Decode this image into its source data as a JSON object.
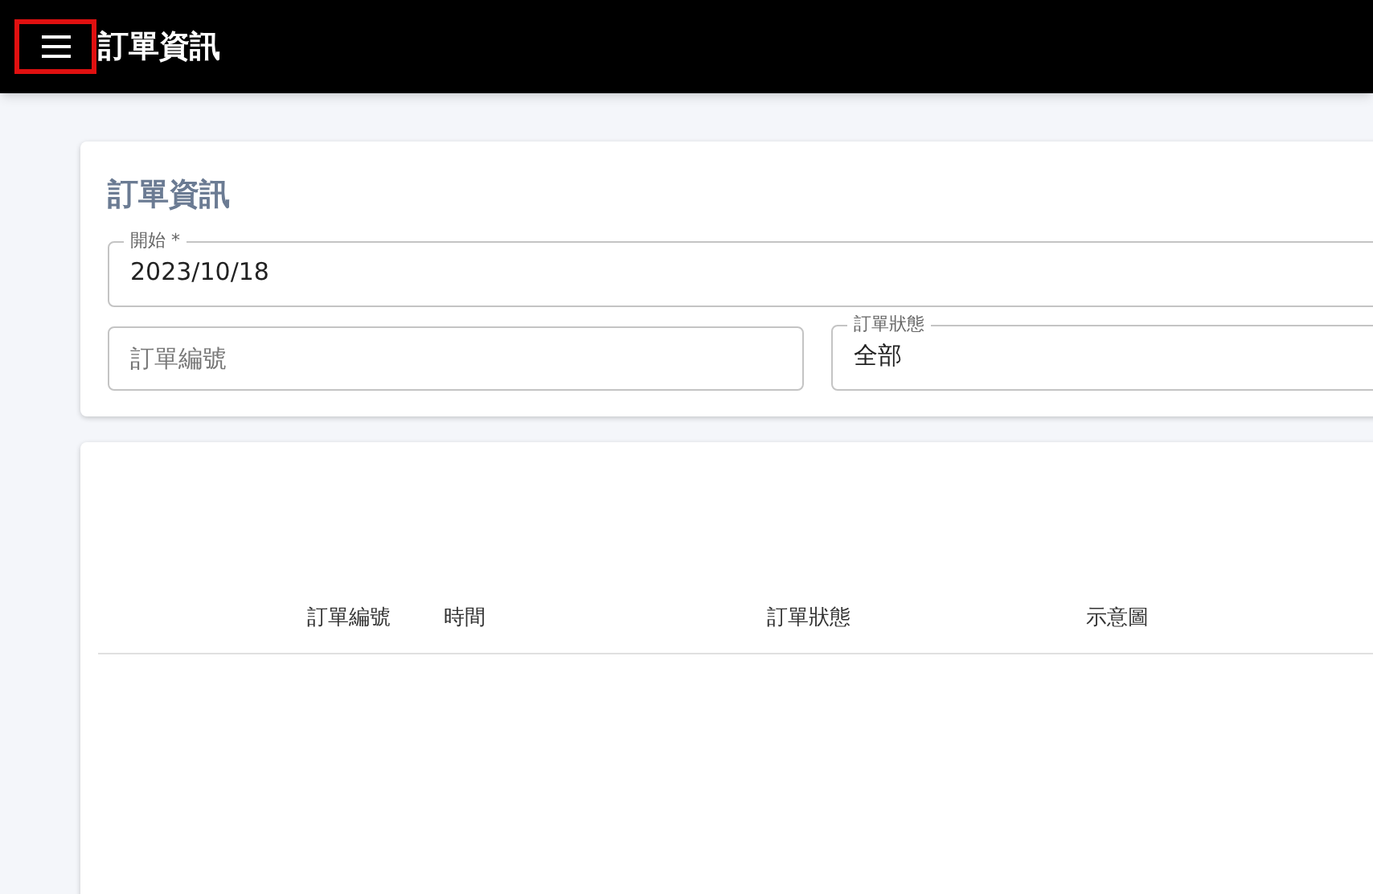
{
  "app_bar": {
    "title": "訂單資訊",
    "menu_highlighted": true
  },
  "filter_card": {
    "title": "訂單資訊",
    "start_field": {
      "label": "開始 *",
      "value": "2023/10/18"
    },
    "order_number_field": {
      "placeholder": "訂單編號"
    },
    "status_field": {
      "label": "訂單狀態",
      "value": "全部"
    }
  },
  "table": {
    "columns": [
      "訂單編號",
      "時間",
      "訂單狀態",
      "示意圖"
    ]
  }
}
